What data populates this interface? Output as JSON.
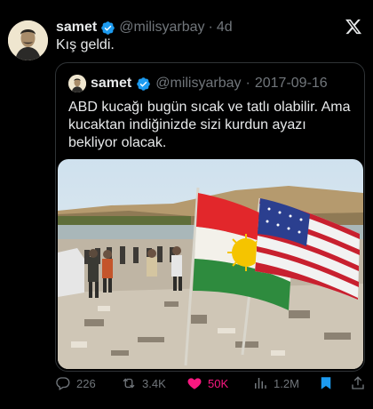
{
  "tweet": {
    "author_name": "samet",
    "handle": "@milisyarbay",
    "separator": "·",
    "time": "4d",
    "text": "Kış geldi."
  },
  "quoted": {
    "author_name": "samet",
    "handle": "@milisyarbay",
    "separator": "·",
    "date": "2017-09-16",
    "text": "ABD kucağı bugün sıcak ve tatlı olabilir. Ama kucaktan indiğinizde sizi kurdun ayazı bekliyor olacak."
  },
  "actions": {
    "replies": "226",
    "reposts": "3.4K",
    "likes": "50K",
    "views": "1.2M"
  },
  "icons": [
    "verified-icon",
    "x-logo-icon",
    "reply-icon",
    "repost-icon",
    "heart-icon",
    "views-icon",
    "bookmark-icon",
    "share-icon"
  ],
  "colors": {
    "background": "#000000",
    "text": "#e7e9ea",
    "muted": "#71767b",
    "verified": "#1d9bf0",
    "like": "#f91880",
    "bookmark": "#1d9bf0"
  }
}
